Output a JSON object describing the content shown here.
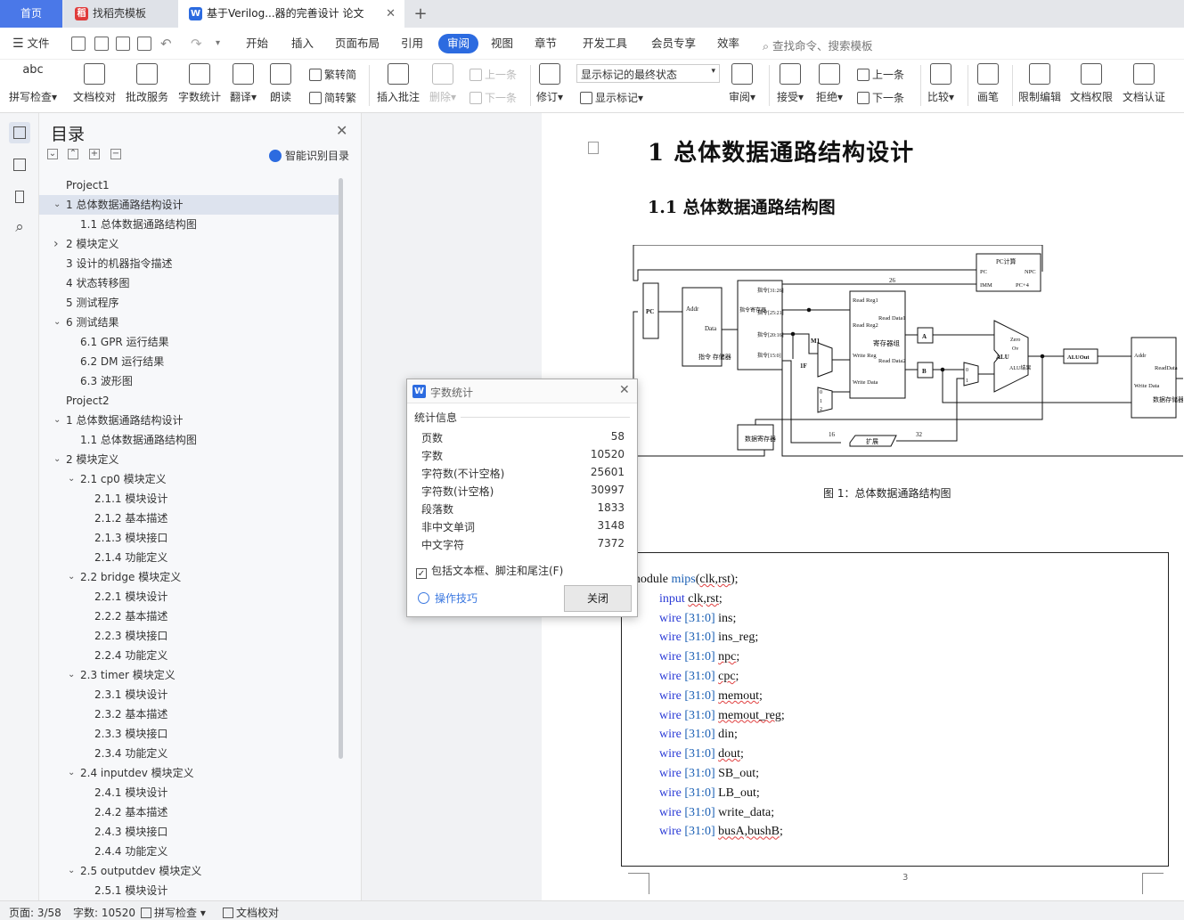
{
  "tabs": {
    "home": "首页",
    "template": "找稻壳模板",
    "document": "基于Verilog...器的完善设计 论文"
  },
  "menu": {
    "file": "文件",
    "items": [
      "开始",
      "插入",
      "页面布局",
      "引用",
      "审阅",
      "视图",
      "章节",
      "开发工具",
      "会员专享",
      "效率"
    ],
    "search_placeholder": "查找命令、搜索模板"
  },
  "ribbon": {
    "spellcheck": "拼写检查",
    "doc_proof": "文档校对",
    "revise_service": "批改服务",
    "word_count": "字数统计",
    "translate": "翻译",
    "read_aloud": "朗读",
    "trad_to_simp": "繁转简",
    "simp_to_trad": "简转繁",
    "insert_comment": "插入批注",
    "delete": "删除",
    "prev_comment": "上一条",
    "next_comment": "下一条",
    "track": "修订",
    "markup_state": "显示标记的最终状态",
    "show_markup": "显示标记",
    "review_pane": "审阅",
    "accept": "接受",
    "reject": "拒绝",
    "prev_change": "上一条",
    "next_change": "下一条",
    "compare": "比较",
    "pen": "画笔",
    "restrict_edit": "限制编辑",
    "doc_permission": "文档权限",
    "doc_cert": "文档认证"
  },
  "toc": {
    "title": "目录",
    "smart_button": "智能识别目录",
    "items": [
      {
        "text": "Project1",
        "level": 0,
        "chev": ""
      },
      {
        "text": "1  总体数据通路结构设计",
        "level": 0,
        "chev": "down",
        "selected": true
      },
      {
        "text": "1.1  总体数据通路结构图",
        "level": 1,
        "chev": ""
      },
      {
        "text": "2  模块定义",
        "level": 0,
        "chev": "right"
      },
      {
        "text": "3  设计的机器指令描述",
        "level": 0,
        "chev": ""
      },
      {
        "text": "4  状态转移图",
        "level": 0,
        "chev": ""
      },
      {
        "text": "5  测试程序",
        "level": 0,
        "chev": ""
      },
      {
        "text": "6  测试结果",
        "level": 0,
        "chev": "down"
      },
      {
        "text": "6.1 GPR 运行结果",
        "level": 1,
        "chev": ""
      },
      {
        "text": "6.2 DM 运行结果",
        "level": 1,
        "chev": ""
      },
      {
        "text": "6.3  波形图",
        "level": 1,
        "chev": ""
      },
      {
        "text": "Project2",
        "level": 0,
        "chev": ""
      },
      {
        "text": "1  总体数据通路结构设计",
        "level": 0,
        "chev": "down"
      },
      {
        "text": "1.1  总体数据通路结构图",
        "level": 1,
        "chev": ""
      },
      {
        "text": "2  模块定义",
        "level": 0,
        "chev": "down"
      },
      {
        "text": "2.1 cp0 模块定义",
        "level": 1,
        "chev": "down"
      },
      {
        "text": "2.1.1  模块设计",
        "level": 2,
        "chev": ""
      },
      {
        "text": "2.1.2  基本描述",
        "level": 2,
        "chev": ""
      },
      {
        "text": "2.1.3  模块接口",
        "level": 2,
        "chev": ""
      },
      {
        "text": "2.1.4  功能定义",
        "level": 2,
        "chev": ""
      },
      {
        "text": "2.2 bridge 模块定义",
        "level": 1,
        "chev": "down"
      },
      {
        "text": "2.2.1  模块设计",
        "level": 2,
        "chev": ""
      },
      {
        "text": "2.2.2  基本描述",
        "level": 2,
        "chev": ""
      },
      {
        "text": "2.2.3  模块接口",
        "level": 2,
        "chev": ""
      },
      {
        "text": "2.2.4  功能定义",
        "level": 2,
        "chev": ""
      },
      {
        "text": "2.3 timer 模块定义",
        "level": 1,
        "chev": "down"
      },
      {
        "text": "2.3.1  模块设计",
        "level": 2,
        "chev": ""
      },
      {
        "text": "2.3.2  基本描述",
        "level": 2,
        "chev": ""
      },
      {
        "text": "2.3.3  模块接口",
        "level": 2,
        "chev": ""
      },
      {
        "text": "2.3.4  功能定义",
        "level": 2,
        "chev": ""
      },
      {
        "text": "2.4 inputdev 模块定义",
        "level": 1,
        "chev": "down"
      },
      {
        "text": "2.4.1  模块设计",
        "level": 2,
        "chev": ""
      },
      {
        "text": "2.4.2  基本描述",
        "level": 2,
        "chev": ""
      },
      {
        "text": "2.4.3  模块接口",
        "level": 2,
        "chev": ""
      },
      {
        "text": "2.4.4  功能定义",
        "level": 2,
        "chev": ""
      },
      {
        "text": "2.5 outputdev 模块定义",
        "level": 1,
        "chev": "down"
      },
      {
        "text": "2.5.1  模块设计",
        "level": 2,
        "chev": ""
      }
    ]
  },
  "document": {
    "heading1": "1  总体数据通路结构设计",
    "heading2": "1.1  总体数据通路结构图",
    "figure_caption": "图 1：总体数据通路结构图",
    "page_number": "3",
    "diagram": {
      "pc": "PC",
      "im_addr": "Addr",
      "im_data": "Data",
      "im_name": "指令\n存储器",
      "ir_name": "指令寄存器",
      "ir_fields": [
        "指令[31:26]",
        "指令[25:21]",
        "指令[20:16]",
        "指令[15:0]"
      ],
      "rf_ports": [
        "Read Reg1",
        "Read Reg2",
        "Write Reg",
        "Write Data"
      ],
      "rf_out": [
        "Read Data1",
        "Read Data2"
      ],
      "rf_name": "寄存器组",
      "npc": "PC计算",
      "npc_ports": [
        "PC",
        "IMM",
        "NPC",
        "PC+4"
      ],
      "a": "A",
      "b": "B",
      "alu": "ALU",
      "alu_out": [
        "Zero",
        "Ov",
        "ALU结果"
      ],
      "aluout": "ALUOut",
      "dm_ports": [
        "Addr",
        "Write Data",
        "ReadData"
      ],
      "dm_name": "数据存储器",
      "dr": "数据寄存器",
      "ext": "扩展",
      "m1": "M1",
      "imm_1f": "1F",
      "widths": [
        "26",
        "16",
        "32"
      ],
      "mux_in": [
        "0",
        "1",
        "2"
      ]
    },
    "code": [
      {
        "segments": [
          {
            "t": "module ",
            "c": "plain"
          },
          {
            "t": "mips",
            "c": "nm"
          },
          {
            "t": "(",
            "c": "plain"
          },
          {
            "t": "clk,rst",
            "c": "wavy"
          },
          {
            "t": ");",
            "c": "plain"
          }
        ]
      },
      {
        "segments": [
          {
            "t": "input ",
            "c": "kw"
          },
          {
            "t": "clk,rst",
            "c": "wavy"
          },
          {
            "t": ";",
            "c": "plain"
          }
        ]
      },
      {
        "segments": [
          {
            "t": "wire ",
            "c": "kw"
          },
          {
            "t": "[31:0] ",
            "c": "nm"
          },
          {
            "t": "ins;",
            "c": "plain"
          }
        ]
      },
      {
        "segments": [
          {
            "t": "wire ",
            "c": "kw"
          },
          {
            "t": "[31:0] ",
            "c": "nm"
          },
          {
            "t": "ins_reg;",
            "c": "plain"
          }
        ]
      },
      {
        "segments": [
          {
            "t": "wire ",
            "c": "kw"
          },
          {
            "t": "[31:0] ",
            "c": "nm"
          },
          {
            "t": "npc",
            "c": "wavy"
          },
          {
            "t": ";",
            "c": "plain"
          }
        ]
      },
      {
        "segments": [
          {
            "t": "wire ",
            "c": "kw"
          },
          {
            "t": "[31:0] ",
            "c": "nm"
          },
          {
            "t": "cpc",
            "c": "wavy"
          },
          {
            "t": ";",
            "c": "plain"
          }
        ]
      },
      {
        "segments": [
          {
            "t": "wire ",
            "c": "kw"
          },
          {
            "t": "[31:0] ",
            "c": "nm"
          },
          {
            "t": "memout",
            "c": "wavy"
          },
          {
            "t": ";",
            "c": "plain"
          }
        ]
      },
      {
        "segments": [
          {
            "t": "wire ",
            "c": "kw"
          },
          {
            "t": "[31:0] ",
            "c": "nm"
          },
          {
            "t": "memout_reg",
            "c": "wavy"
          },
          {
            "t": ";",
            "c": "plain"
          }
        ]
      },
      {
        "segments": [
          {
            "t": "wire ",
            "c": "kw"
          },
          {
            "t": "[31:0] ",
            "c": "nm"
          },
          {
            "t": "din;",
            "c": "plain"
          }
        ]
      },
      {
        "segments": [
          {
            "t": "wire ",
            "c": "kw"
          },
          {
            "t": "[31:0] ",
            "c": "nm"
          },
          {
            "t": "dout",
            "c": "wavy"
          },
          {
            "t": ";",
            "c": "plain"
          }
        ]
      },
      {
        "segments": [
          {
            "t": "wire ",
            "c": "kw"
          },
          {
            "t": "[31:0] ",
            "c": "nm"
          },
          {
            "t": "SB_out;",
            "c": "plain"
          }
        ]
      },
      {
        "segments": [
          {
            "t": "wire ",
            "c": "kw"
          },
          {
            "t": "[31:0] ",
            "c": "nm"
          },
          {
            "t": "LB_out;",
            "c": "plain"
          }
        ]
      },
      {
        "segments": [
          {
            "t": "wire ",
            "c": "kw"
          },
          {
            "t": "[31:0] ",
            "c": "nm"
          },
          {
            "t": "write_data;",
            "c": "plain"
          }
        ]
      },
      {
        "segments": [
          {
            "t": "wire ",
            "c": "kw"
          },
          {
            "t": "[31:0] ",
            "c": "nm"
          },
          {
            "t": "busA,bushB",
            "c": "wavy"
          },
          {
            "t": ";",
            "c": "plain"
          }
        ]
      }
    ]
  },
  "dialog": {
    "title": "字数统计",
    "group": "统计信息",
    "stats": [
      {
        "label": "页数",
        "value": "58"
      },
      {
        "label": "字数",
        "value": "10520"
      },
      {
        "label": "字符数(不计空格)",
        "value": "25601"
      },
      {
        "label": "字符数(计空格)",
        "value": "30997"
      },
      {
        "label": "段落数",
        "value": "1833"
      },
      {
        "label": "非中文单词",
        "value": "3148"
      },
      {
        "label": "中文字符",
        "value": "7372"
      }
    ],
    "checkbox": "包括文本框、脚注和尾注(F)",
    "checked": true,
    "tips": "操作技巧",
    "close": "关闭"
  },
  "status": {
    "page": "页面: 3/58",
    "words": "字数: 10520",
    "spellcheck": "拼写检查",
    "proof": "文档校对"
  }
}
